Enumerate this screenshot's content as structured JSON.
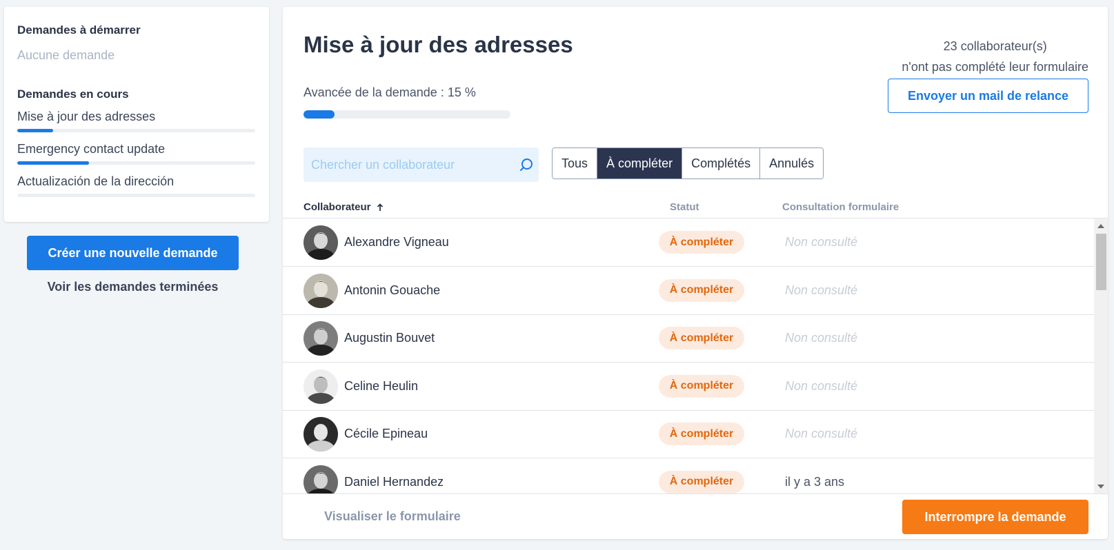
{
  "sidebar": {
    "to_start_heading": "Demandes à démarrer",
    "to_start_empty": "Aucune demande",
    "in_progress_heading": "Demandes en cours",
    "requests": [
      {
        "label": "Mise à jour des adresses",
        "progress": 0.15
      },
      {
        "label": "Emergency contact update",
        "progress": 0.3
      },
      {
        "label": "Actualización de la dirección",
        "progress": 0.0
      }
    ],
    "create_button": "Créer une nouvelle demande",
    "finished_link": "Voir les demandes terminées"
  },
  "main": {
    "title": "Mise à jour des adresses",
    "progress_label": "Avancée de la demande : 15 %",
    "progress": 0.15,
    "summary_line1": "23 collaborateur(s)",
    "summary_line2": "n'ont pas complété leur formulaire",
    "reminder_button": "Envoyer un mail de relance",
    "search_placeholder": "Chercher un collaborateur",
    "filters": [
      {
        "label": "Tous",
        "active": false
      },
      {
        "label": "À compléter",
        "active": true
      },
      {
        "label": "Complétés",
        "active": false
      },
      {
        "label": "Annulés",
        "active": false
      }
    ],
    "columns": {
      "collaborator": "Collaborateur",
      "sort_icon": "arrow-up-icon",
      "status": "Statut",
      "consultation": "Consultation formulaire"
    },
    "rows": [
      {
        "name": "Alexandre Vigneau",
        "status": "À compléter",
        "consultation": "Non consulté"
      },
      {
        "name": "Antonin Gouache",
        "status": "À compléter",
        "consultation": "Non consulté"
      },
      {
        "name": "Augustin Bouvet",
        "status": "À compléter",
        "consultation": "Non consulté"
      },
      {
        "name": "Celine Heulin",
        "status": "À compléter",
        "consultation": "Non consulté"
      },
      {
        "name": "Cécile Epineau",
        "status": "À compléter",
        "consultation": "Non consulté"
      },
      {
        "name": "Daniel Hernandez",
        "status": "À compléter",
        "consultation": "il y a 3 ans"
      }
    ],
    "view_form_link": "Visualiser le formulaire",
    "stop_button": "Interrompre la demande"
  },
  "colors": {
    "primary": "#1a7ae6",
    "accent_orange": "#f67a15",
    "badge_text": "#e3670c",
    "badge_bg": "#fdeadf",
    "active_tab": "#2b3550"
  }
}
